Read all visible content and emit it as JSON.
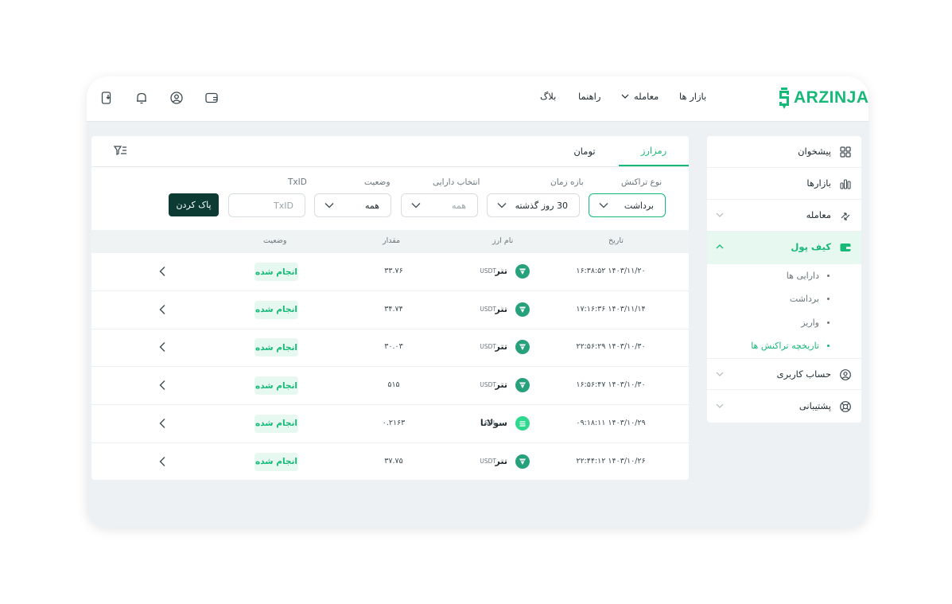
{
  "colors": {
    "accent": "#17b978",
    "dark_button": "#0c3b34",
    "usdt": "#26a17b",
    "sol": "#2ed88f"
  },
  "header": {
    "logo_text": "ARZINJA",
    "nav": {
      "markets": "بازار ها",
      "trade": "معامله",
      "guide": "راهنما",
      "blog": "بلاگ"
    },
    "icons": [
      "wallet-icon",
      "user-icon",
      "bell-icon",
      "mobile-download-icon"
    ]
  },
  "sidebar": {
    "dashboard": "پیشخوان",
    "markets": "بازارها",
    "trade": "معامله",
    "wallet": "کیف پول",
    "wallet_sub": [
      "دارایی ها",
      "برداشت",
      "واریز",
      "تاریخچه تراکنش ها"
    ],
    "account": "حساب کاربری",
    "support": "پشتیبانی"
  },
  "main": {
    "tabs": {
      "crypto": "رمزارز",
      "toman": "تومان"
    },
    "filters": {
      "type_label": "نوع تراکنش",
      "type_value": "برداشت",
      "range_label": "بازه زمان",
      "range_value": "30 روز گذشته",
      "asset_label": "انتخاب دارایی",
      "asset_value": "همه",
      "status_label": "وضعیت",
      "status_value": "همه",
      "txid_label": "TxID",
      "txid_placeholder": "TxID",
      "clear_label": "پاک کردن"
    },
    "table": {
      "headers": {
        "date": "تاریخ",
        "currency": "نام ارز",
        "amount": "مقدار",
        "status": "وضعیت"
      },
      "rows": [
        {
          "date": "۱۴۰۳/۱۱/۲۰ ۱۶:۳۸:۵۲",
          "coin": "تتر",
          "symbol": "USDT",
          "amount": "۳۳.۷۶",
          "status": "انجام شده"
        },
        {
          "date": "۱۴۰۳/۱۱/۱۴ ۱۷:۱۶:۳۶",
          "coin": "تتر",
          "symbol": "USDT",
          "amount": "۳۴.۷۴",
          "status": "انجام شده"
        },
        {
          "date": "۱۴۰۳/۱۰/۳۰ ۲۲:۵۶:۲۹",
          "coin": "تتر",
          "symbol": "USDT",
          "amount": "۳۰.۰۳",
          "status": "انجام شده"
        },
        {
          "date": "۱۴۰۳/۱۰/۳۰ ۱۶:۵۶:۴۷",
          "coin": "تتر",
          "symbol": "USDT",
          "amount": "۵۱۵",
          "status": "انجام شده"
        },
        {
          "date": "۱۴۰۳/۱۰/۲۹ ۰۹:۱۸:۱۱",
          "coin": "سولانا",
          "symbol": "SOL",
          "amount": "۰.۲۱۶۳",
          "status": "انجام شده"
        },
        {
          "date": "۱۴۰۳/۱۰/۲۶ ۲۲:۴۴:۱۲",
          "coin": "تتر",
          "symbol": "USDT",
          "amount": "۳۷.۷۵",
          "status": "انجام شده"
        }
      ]
    }
  }
}
